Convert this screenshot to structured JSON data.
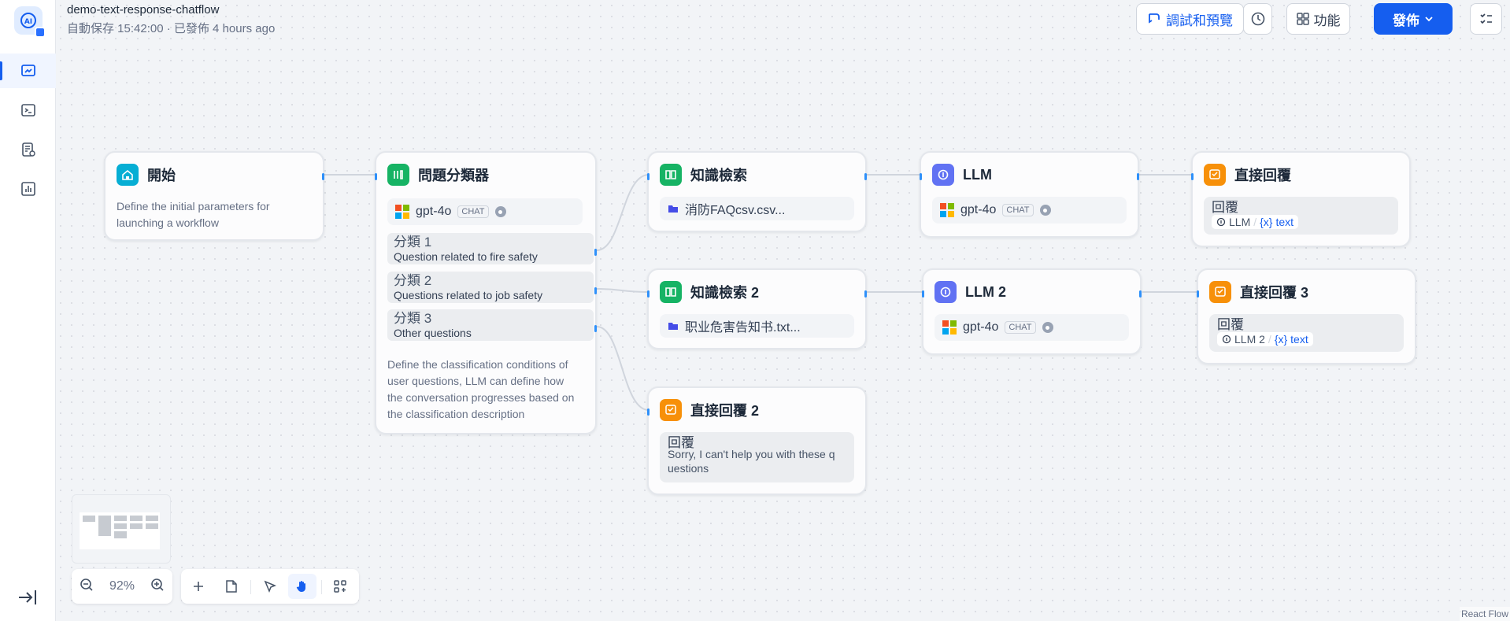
{
  "header": {
    "title": "demo-text-response-chatflow",
    "subtitle": "自動保存 15:42:00 · 已發佈 4 hours ago"
  },
  "toolbar": {
    "preview_label": "調試和預覽",
    "features_label": "功能",
    "publish_label": "發佈"
  },
  "colors": {
    "accent": "#155eef",
    "start_icon": "#06aed4",
    "classifier_icon": "#16b364",
    "knowledge_icon": "#16b364",
    "llm_icon": "#6172f3",
    "answer_icon": "#f79009",
    "edge": "#d0d5dd",
    "handle": "#2e90fa"
  },
  "nodes": {
    "start": {
      "title": "開始",
      "icon": "home-icon",
      "desc_line1": "Define the initial parameters for",
      "desc_line2": "launching a workflow"
    },
    "classifier": {
      "title": "問題分類器",
      "icon": "classifier-icon",
      "model": "gpt-4o",
      "mode": "CHAT",
      "classes": [
        {
          "name": "分類 1",
          "desc": "Question related to fire safety"
        },
        {
          "name": "分類 2",
          "desc": "Questions related to job safety"
        },
        {
          "name": "分類 3",
          "desc": "Other questions"
        }
      ],
      "desc_lines": [
        "Define the classification conditions of",
        "user questions, LLM can define how",
        "the conversation progresses based on",
        "the classification description"
      ]
    },
    "knowledge1": {
      "title": "知識檢索",
      "icon": "book-icon",
      "dataset": "消防FAQcsv.csv..."
    },
    "knowledge2": {
      "title": "知識檢索 2",
      "icon": "book-icon",
      "dataset": "职业危害告知书.txt..."
    },
    "answer2": {
      "title": "直接回覆 2",
      "icon": "reply-icon",
      "label": "回覆",
      "text_line1": "Sorry, I can't help you with these q",
      "text_line2": "uestions"
    },
    "llm1": {
      "title": "LLM",
      "icon": "llm-icon",
      "model": "gpt-4o",
      "mode": "CHAT"
    },
    "llm2": {
      "title": "LLM 2",
      "icon": "llm-icon",
      "model": "gpt-4o",
      "mode": "CHAT"
    },
    "answer1": {
      "title": "直接回覆",
      "icon": "reply-icon",
      "label": "回覆",
      "var_node": "LLM",
      "var_name": "text"
    },
    "answer3": {
      "title": "直接回覆 3",
      "icon": "reply-icon",
      "label": "回覆",
      "var_node": "LLM 2",
      "var_name": "text"
    }
  },
  "zoom": {
    "level": "92%"
  },
  "attribution": "React Flow"
}
